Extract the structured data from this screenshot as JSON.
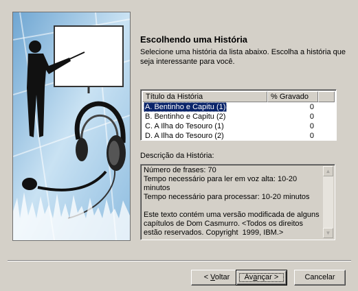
{
  "header": {
    "title": "Escolhendo uma História",
    "description": "Selecione uma história da lista abaixo. Escolha a história que seja interessante para você."
  },
  "story_list": {
    "columns": [
      "Título da História",
      "% Gravado"
    ],
    "rows": [
      {
        "title": "A. Bentinho e Capitu (1)",
        "recorded": "0",
        "selected": true
      },
      {
        "title": "B. Bentinho e Capitu (2)",
        "recorded": "0",
        "selected": false
      },
      {
        "title": "C. A Ilha do Tesouro (1)",
        "recorded": "0",
        "selected": false
      },
      {
        "title": "D. A Ilha do Tesouro (2)",
        "recorded": "0",
        "selected": false
      }
    ]
  },
  "story_description": {
    "label": "Descrição da História:",
    "text": "Número de frases: 70\nTempo necessário para ler em voz alta: 10-20 minutos\nTempo necessário para processar: 10-20 minutos\n\nEste texto contém uma versão modificada de alguns capítulos de Dom Casmurro. <Todos os direitos estão reservados. Copyright  1999, IBM.>"
  },
  "buttons": {
    "back": {
      "prefix": "< ",
      "mnemonic": "V",
      "rest": "oltar"
    },
    "next": {
      "prefix": "Av",
      "mnemonic": "a",
      "rest": "nçar >"
    },
    "cancel": "Cancelar"
  },
  "icons": {
    "scroll_up": "scroll-up-arrow-icon",
    "scroll_down": "scroll-down-arrow-icon"
  },
  "colors": {
    "dialog_bg": "#d4d0c8",
    "selection": "#0a246a"
  }
}
